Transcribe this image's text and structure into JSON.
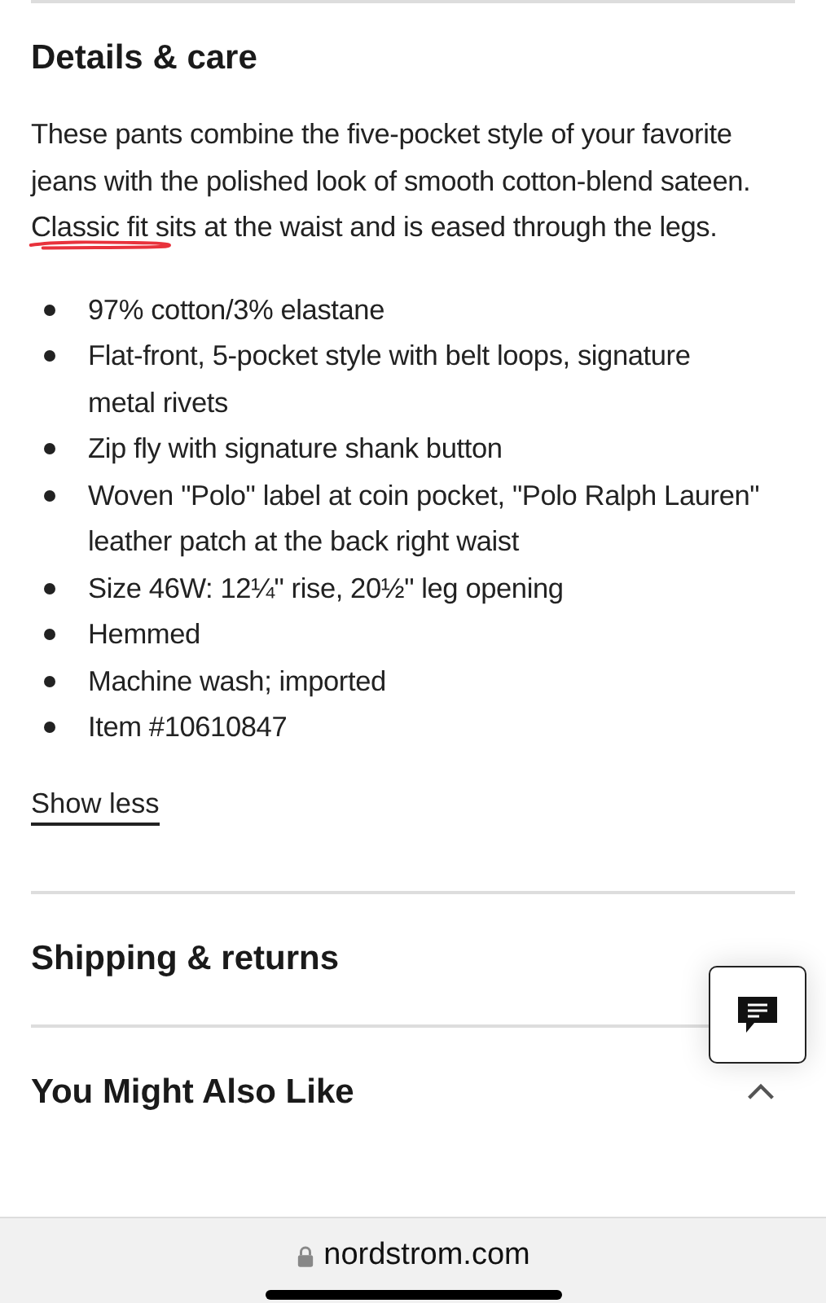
{
  "details": {
    "title": "Details & care",
    "description": [
      {
        "text": "These pants combine the five-pocket style of your favorite jeans with the polished look of smooth cotton-blend sateen. ",
        "scribbled": false
      },
      {
        "text": "Classic fit",
        "scribbled": true
      },
      {
        "text": " sits at the waist and is eased through the legs.",
        "scribbled": false
      }
    ],
    "bullets": [
      "97% cotton/3% elastane",
      "Flat-front, 5-pocket style with belt loops, signature metal rivets",
      "Zip fly with signature shank button",
      "Woven \"Polo\" label at coin pocket, \"Polo Ralph Lauren\" leather patch at the back right waist",
      "Size 46W: 12¼\" rise, 20½\" leg opening",
      "Hemmed",
      "Machine wash; imported",
      "Item #10610847"
    ],
    "toggle": "Show less"
  },
  "shipping": {
    "title": "Shipping & returns"
  },
  "also_like": {
    "title": "You Might Also Like",
    "expanded": true
  },
  "browser": {
    "url": "nordstrom.com"
  }
}
